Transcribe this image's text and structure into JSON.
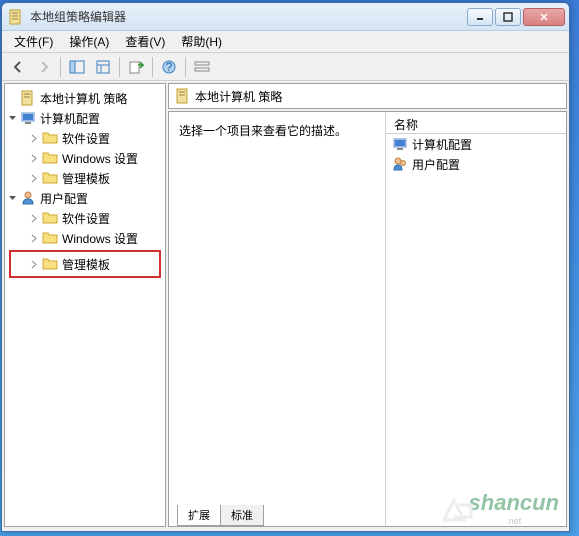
{
  "window": {
    "title": "本地组策略编辑器"
  },
  "menu": {
    "file": "文件(F)",
    "action": "操作(A)",
    "view": "查看(V)",
    "help": "帮助(H)"
  },
  "tree": {
    "root": "本地计算机 策略",
    "computer_config": "计算机配置",
    "user_config": "用户配置",
    "software_settings": "软件设置",
    "windows_settings": "Windows 设置",
    "admin_templates": "管理模板"
  },
  "right": {
    "header": "本地计算机 策略",
    "description": "选择一个项目来查看它的描述。",
    "column_name": "名称",
    "items": {
      "computer": "计算机配置",
      "user": "用户配置"
    }
  },
  "tabs": {
    "extended": "扩展",
    "standard": "标准"
  },
  "watermark": {
    "main": "shancun",
    "sub": ".net"
  }
}
